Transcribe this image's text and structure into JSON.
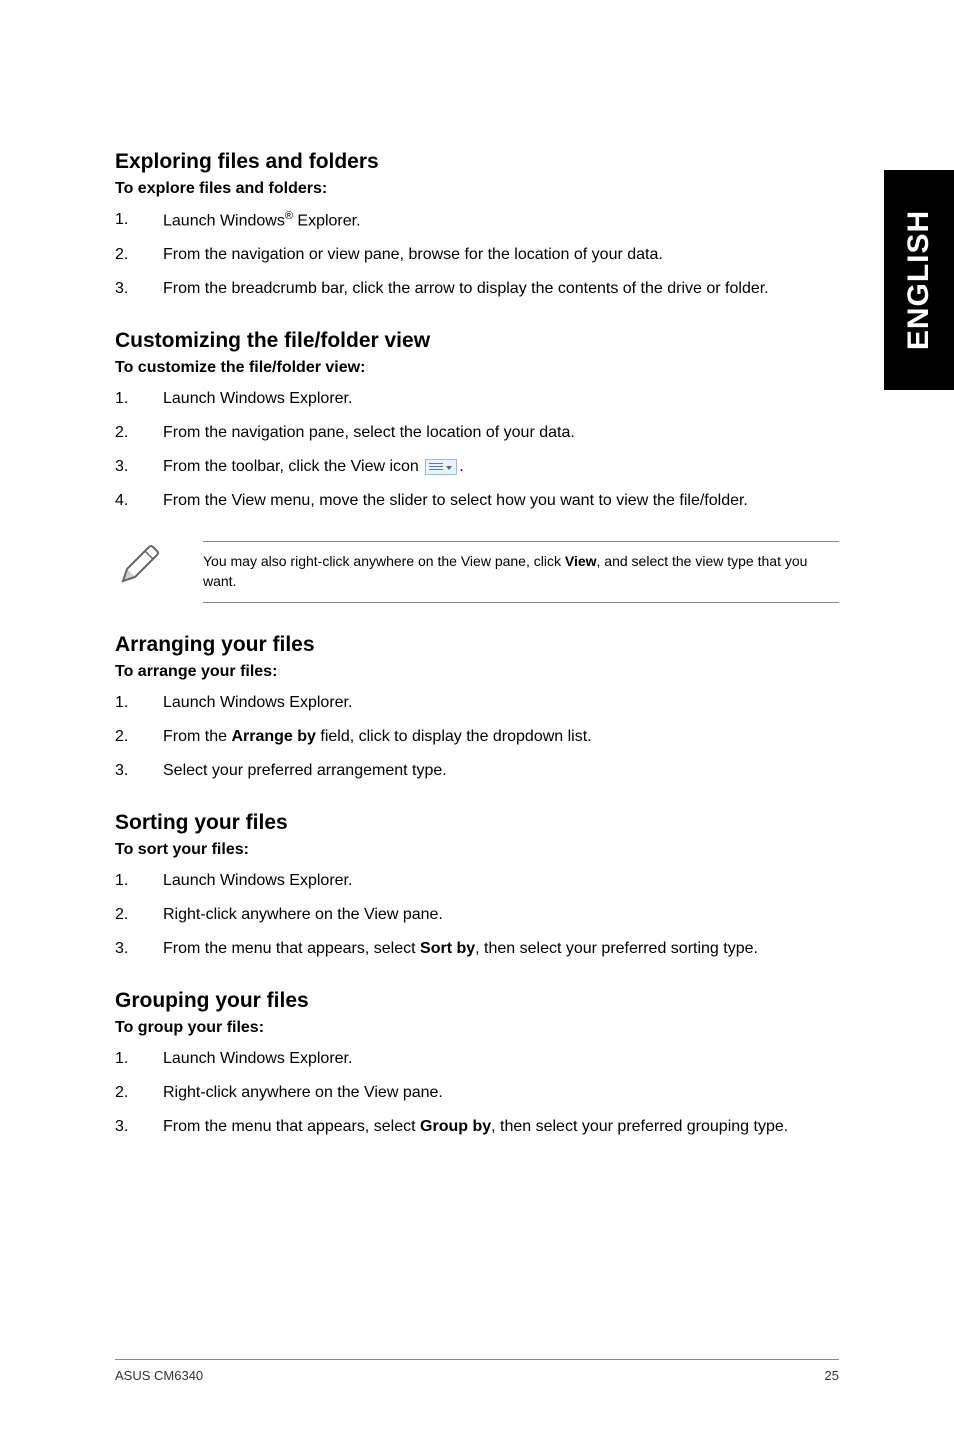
{
  "sideTab": "ENGLISH",
  "sections": [
    {
      "title": "Exploring files and folders",
      "subhead": "To explore files and folders:",
      "steps": [
        {
          "num": "1.",
          "html": "Launch Windows<span class='sup'>®</span> Explorer."
        },
        {
          "num": "2.",
          "html": "From the navigation or view pane, browse for the location of your data."
        },
        {
          "num": "3.",
          "html": "From the breadcrumb bar, click the arrow to display the contents of the drive or folder."
        }
      ]
    },
    {
      "title": "Customizing the file/folder view",
      "subhead": "To customize the file/folder view:",
      "steps": [
        {
          "num": "1.",
          "html": "Launch Windows Explorer."
        },
        {
          "num": "2.",
          "html": "From the navigation pane, select the location of your data."
        },
        {
          "num": "3.",
          "html": "From the toolbar, click the View icon <span class='view-icon' data-name='view-dropdown-icon' data-interactable='false'></span>."
        },
        {
          "num": "4.",
          "html": "From the View menu, move the slider to select how you want to view the file/folder."
        }
      ],
      "note": "You may also right-click anywhere on the View pane, click <b>View</b>, and select the view type that you want."
    },
    {
      "title": "Arranging your files",
      "subhead": "To arrange your files:",
      "steps": [
        {
          "num": "1.",
          "html": "Launch Windows Explorer."
        },
        {
          "num": "2.",
          "html": "From the <b>Arrange by</b> field, click to display the dropdown list."
        },
        {
          "num": "3.",
          "html": "Select your preferred arrangement type."
        }
      ]
    },
    {
      "title": "Sorting your files",
      "subhead": "To sort your files:",
      "steps": [
        {
          "num": "1.",
          "html": "Launch Windows Explorer."
        },
        {
          "num": "2.",
          "html": "Right-click anywhere on the View pane."
        },
        {
          "num": "3.",
          "html": "From the menu that appears, select <b>Sort by</b>, then select your preferred sorting type."
        }
      ]
    },
    {
      "title": "Grouping your files",
      "subhead": "To group your files:",
      "steps": [
        {
          "num": "1.",
          "html": "Launch Windows Explorer."
        },
        {
          "num": "2.",
          "html": "Right-click anywhere on the View pane."
        },
        {
          "num": "3.",
          "html": "From the menu that appears, select <b>Group by</b>, then select your preferred grouping type."
        }
      ]
    }
  ],
  "footer": {
    "left": "ASUS CM6340",
    "right": "25"
  }
}
